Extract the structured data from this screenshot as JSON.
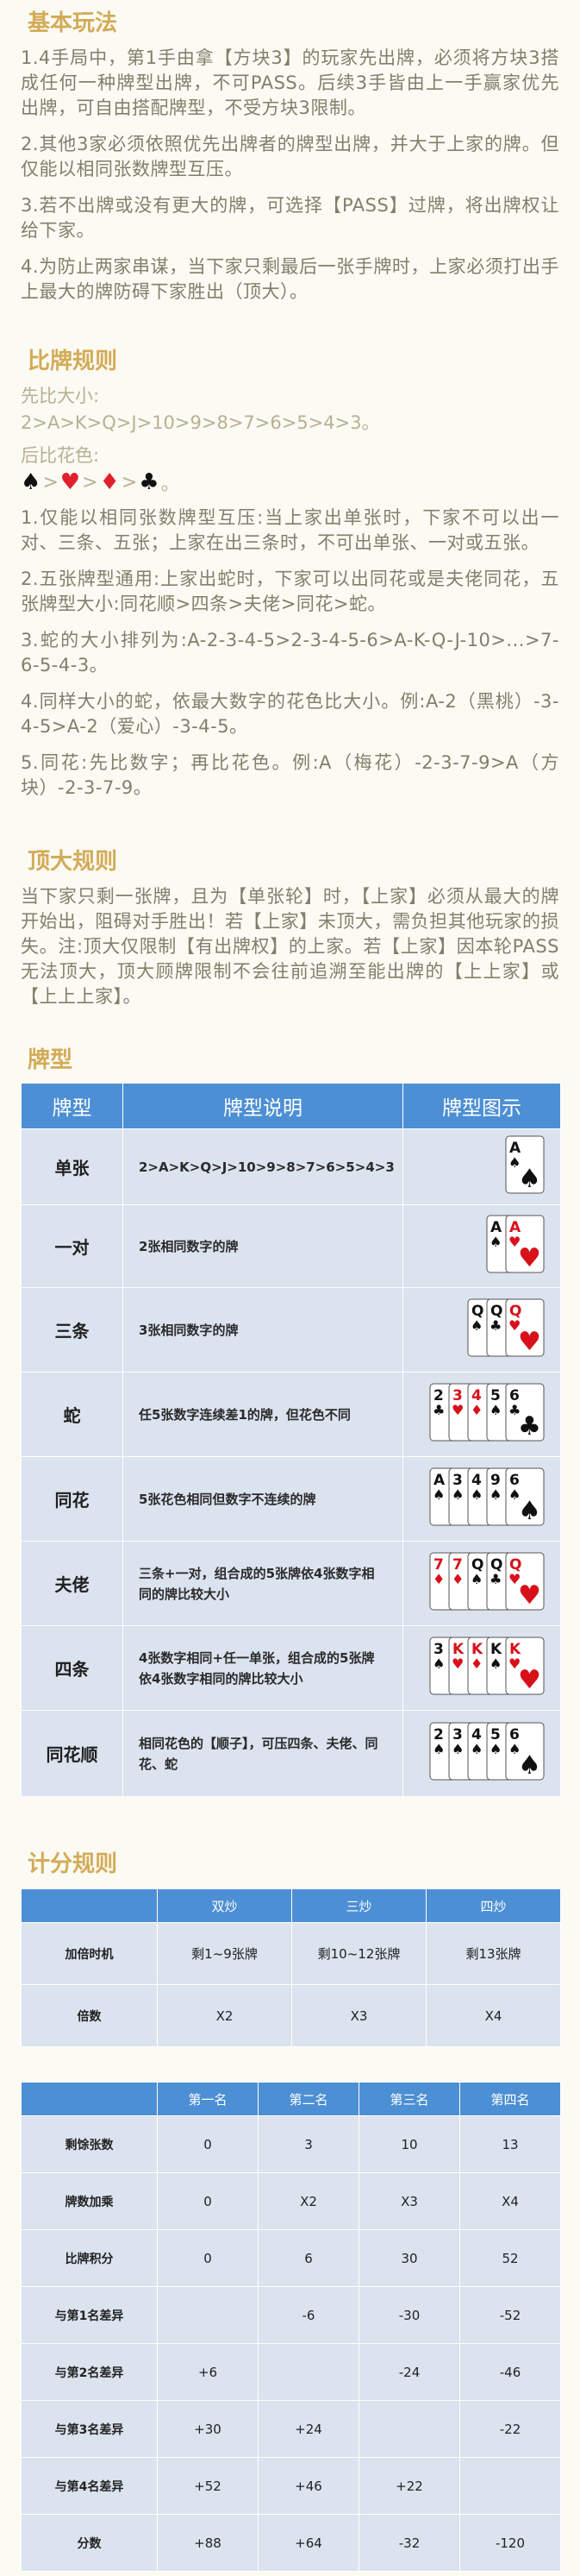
{
  "sections": {
    "basic": {
      "title": "基本玩法",
      "paras": [
        "1.4手局中，第1手由拿【方块3】的玩家先出牌，必须将方块3搭成任何一种牌型出牌，不可PASS。后续3手皆由上一手赢家优先出牌，可自由搭配牌型，不受方块3限制。",
        "2.其他3家必须依照优先出牌者的牌型出牌，并大于上家的牌。但仅能以相同张数牌型互压。",
        "3.若不出牌或没有更大的牌，可选择【PASS】过牌，将出牌权让给下家。",
        "4.为防止两家串谋，当下家只剩最后一张手牌时，上家必须打出手上最大的牌防碍下家胜出（顶大）。"
      ]
    },
    "compare": {
      "title": "比牌规则",
      "first_label": "先比大小:",
      "order": "2>A>K>Q>J>10>9>8>7>6>5>4>3。",
      "second_label": "后比花色:",
      "suits": [
        "♠",
        "♥",
        "♦",
        "♣"
      ],
      "suit_sep": ">",
      "suit_end": "。",
      "paras": [
        "1.仅能以相同张数牌型互压:当上家出单张时，下家不可以出一对、三条、五张；上家在出三条时，不可出单张、一对或五张。",
        "2.五张牌型通用:上家出蛇时，下家可以出同花或是夫佬同花，五张牌型大小:同花顺>四条>夫佬>同花>蛇。",
        "3.蛇的大小排列为:A-2-3-4-5>2-3-4-5-6>A-K-Q-J-10>...>7-6-5-4-3。",
        "4.同样大小的蛇，依最大数字的花色比大小。例:A-2（黑桃）-3-4-5>A-2（爱心）-3-4-5。",
        "5.同花:先比数字；再比花色。例:A（梅花）-2-3-7-9>A（方块）-2-3-7-9。"
      ]
    },
    "top": {
      "title": "顶大规则",
      "para": "当下家只剩一张牌，且为【单张轮】时，【上家】必须从最大的牌开始出，阻碍对手胜出！若【上家】未顶大，需负担其他玩家的损失。注:顶大仅限制【有出牌权】的上家。若【上家】因本轮PASS无法顶大，顶大顾牌限制不会往前追溯至能出牌的【上上家】或【上上上家】。"
    },
    "types": {
      "title": "牌型",
      "headers": [
        "牌型",
        "牌型说明",
        "牌型图示"
      ],
      "rows": [
        {
          "name": "单张",
          "desc": "2>A>K>Q>J>10>9>8>7>6>5>4>3"
        },
        {
          "name": "一对",
          "desc": "2张相同数字的牌"
        },
        {
          "name": "三条",
          "desc": "3张相同数字的牌"
        },
        {
          "name": "蛇",
          "desc": "任5张数字连续差1的牌，但花色不同"
        },
        {
          "name": "同花",
          "desc": "5张花色相同但数字不连续的牌"
        },
        {
          "name": "夫佬",
          "desc": "三条+一对，组合成的5张牌依4张数字相同的牌比较大小"
        },
        {
          "name": "四条",
          "desc": "4张数字相同+任一单张，组合成的5张牌依4张数字相同的牌比较大小"
        },
        {
          "name": "同花顺",
          "desc": "相同花色的【顺子】，可压四条、夫佬、同花、蛇"
        }
      ],
      "card_images": [
        [
          [
            "A",
            "♠",
            "b"
          ]
        ],
        [
          [
            "A",
            "♠",
            "b"
          ],
          [
            "A",
            "♥",
            "r"
          ]
        ],
        [
          [
            "Q",
            "♠",
            "b"
          ],
          [
            "Q",
            "♣",
            "b"
          ],
          [
            "Q",
            "♥",
            "r"
          ]
        ],
        [
          [
            "2",
            "♣",
            "b"
          ],
          [
            "3",
            "♥",
            "r"
          ],
          [
            "4",
            "♦",
            "r"
          ],
          [
            "5",
            "♠",
            "b"
          ],
          [
            "6",
            "♣",
            "b"
          ]
        ],
        [
          [
            "A",
            "♠",
            "b"
          ],
          [
            "3",
            "♠",
            "b"
          ],
          [
            "4",
            "♠",
            "b"
          ],
          [
            "9",
            "♠",
            "b"
          ],
          [
            "6",
            "♠",
            "b"
          ]
        ],
        [
          [
            "7",
            "♦",
            "r"
          ],
          [
            "7",
            "♦",
            "r"
          ],
          [
            "Q",
            "♠",
            "b"
          ],
          [
            "Q",
            "♣",
            "b"
          ],
          [
            "Q",
            "♥",
            "r"
          ]
        ],
        [
          [
            "3",
            "♠",
            "b"
          ],
          [
            "K",
            "♥",
            "r"
          ],
          [
            "K",
            "♦",
            "r"
          ],
          [
            "K",
            "♠",
            "b"
          ],
          [
            "K",
            "♥",
            "r"
          ]
        ],
        [
          [
            "2",
            "♠",
            "b"
          ],
          [
            "3",
            "♠",
            "b"
          ],
          [
            "4",
            "♠",
            "b"
          ],
          [
            "5",
            "♠",
            "b"
          ],
          [
            "6",
            "♠",
            "b"
          ]
        ]
      ]
    },
    "score": {
      "title": "计分规则",
      "t1": {
        "headers": [
          "",
          "双炒",
          "三炒",
          "四炒"
        ],
        "rows": [
          [
            "加倍时机",
            "剩1~9张牌",
            "剩10~12张牌",
            "剩13张牌"
          ],
          [
            "倍数",
            "X2",
            "X3",
            "X4"
          ]
        ]
      },
      "t2": {
        "headers": [
          "",
          "第一名",
          "第二名",
          "第三名",
          "第四名"
        ],
        "rows": [
          [
            "剩馀张数",
            "0",
            "3",
            "10",
            "13"
          ],
          [
            "牌数加乘",
            "0",
            "X2",
            "X3",
            "X4"
          ],
          [
            "比牌积分",
            "0",
            "6",
            "30",
            "52"
          ],
          [
            "与第1名差异",
            "",
            "-6",
            "-30",
            "-52"
          ],
          [
            "与第2名差异",
            "+6",
            "",
            "-24",
            "-46"
          ],
          [
            "与第3名差异",
            "+30",
            "+24",
            "",
            "-22"
          ],
          [
            "与第4名差异",
            "+52",
            "+46",
            "+22",
            ""
          ],
          [
            "分数",
            "+88",
            "+64",
            "-32",
            "-120"
          ]
        ]
      }
    }
  }
}
